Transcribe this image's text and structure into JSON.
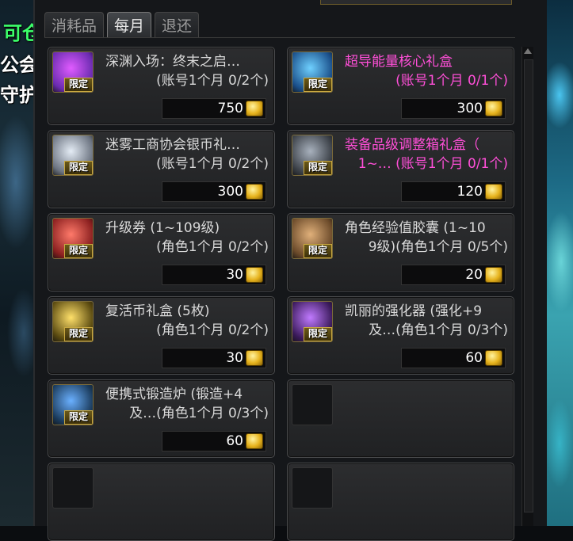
{
  "background": {
    "left_text": [
      "可仓",
      "公会",
      "守护"
    ]
  },
  "tabs": [
    {
      "label": "消耗品",
      "active": false
    },
    {
      "label": "每月",
      "active": true
    },
    {
      "label": "退还",
      "active": false
    }
  ],
  "items": [
    {
      "name": "深渊入场：终末之启…",
      "limit": "(账号1个月 0/2个)",
      "price": "750",
      "tag": "限定",
      "highlight": false,
      "icon": "abyss-ticket-icon",
      "icon_colors": [
        "#6a2bb0",
        "#e05cff"
      ]
    },
    {
      "name": "超导能量核心礼盒",
      "limit": "(账号1个月 0/1个)",
      "price": "300",
      "tag": "限定",
      "highlight": true,
      "icon": "energy-core-box-icon",
      "icon_colors": [
        "#1a4f8a",
        "#6fd0ff"
      ]
    },
    {
      "name": "迷雾工商协会银币礼…",
      "limit": "(账号1个月 0/2个)",
      "price": "300",
      "tag": "限定",
      "highlight": false,
      "icon": "silver-coin-gift-icon",
      "icon_colors": [
        "#6b7380",
        "#e4ecf5"
      ]
    },
    {
      "name": "装备品级调整箱礼盒（",
      "limit": "1~… (账号1个月 0/1个)",
      "price": "120",
      "tag": "限定",
      "highlight": true,
      "icon": "grade-adjust-box-icon",
      "icon_colors": [
        "#3a3f46",
        "#a8b1bd"
      ]
    },
    {
      "name": "升级券 (1~109级)",
      "limit": "(角色1个月 0/2个)",
      "price": "30",
      "tag": "限定",
      "highlight": false,
      "icon": "level-up-ticket-icon",
      "icon_colors": [
        "#8a1f1f",
        "#ff7a6a"
      ]
    },
    {
      "name": "角色经验值胶囊 (1~10",
      "limit": "9级)(角色1个月 0/5个)",
      "price": "20",
      "tag": "限定",
      "highlight": false,
      "icon": "exp-capsule-icon",
      "icon_colors": [
        "#6b4a2a",
        "#e0b07a"
      ]
    },
    {
      "name": "复活币礼盒 (5枚)",
      "limit": "(角色1个月 0/2个)",
      "price": "30",
      "tag": "限定",
      "highlight": false,
      "icon": "revive-coin-box-icon",
      "icon_colors": [
        "#5a4a10",
        "#ffe06a"
      ]
    },
    {
      "name": "凯丽的强化器 (强化+9",
      "limit": "及…(角色1个月 0/3个)",
      "price": "60",
      "tag": "限定",
      "highlight": false,
      "icon": "enhancer-icon",
      "icon_colors": [
        "#3a1a5a",
        "#c07aff"
      ]
    },
    {
      "name": "便携式锻造炉 (锻造+4",
      "limit": "及…(角色1个月 0/3个)",
      "price": "60",
      "tag": "限定",
      "highlight": false,
      "icon": "forge-icon",
      "icon_colors": [
        "#1a3a5a",
        "#6ab0ff"
      ]
    }
  ],
  "empty_slots": 3,
  "colors": {
    "highlight_text": "#ff4fd8",
    "normal_text": "#d9d9d9",
    "coin": "#e6b21c"
  }
}
